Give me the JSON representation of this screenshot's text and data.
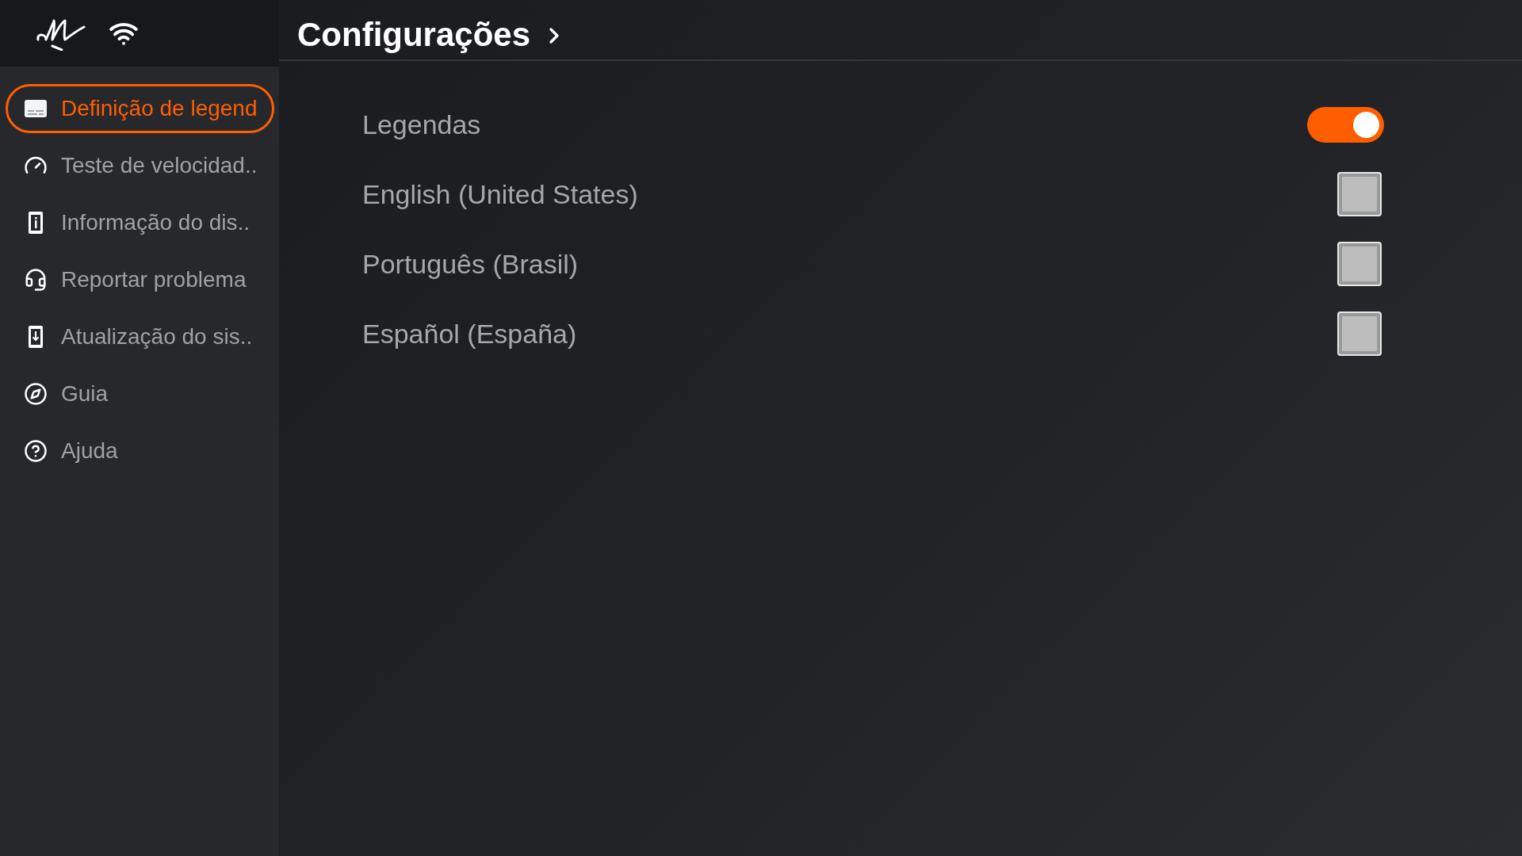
{
  "header": {
    "title": "Configurações"
  },
  "sidebar": {
    "items": [
      {
        "label": "Definição de legend",
        "selected": true
      },
      {
        "label": "Teste de velocidad..",
        "selected": false
      },
      {
        "label": "Informação do dis..",
        "selected": false
      },
      {
        "label": "Reportar problema",
        "selected": false
      },
      {
        "label": "Atualização do sis..",
        "selected": false
      },
      {
        "label": "Guia",
        "selected": false
      },
      {
        "label": "Ajuda",
        "selected": false
      }
    ]
  },
  "settings": {
    "rows": [
      {
        "kind": "toggle",
        "label": "Legendas",
        "on": true
      },
      {
        "kind": "checkbox",
        "label": "English (United States)",
        "checked": false
      },
      {
        "kind": "checkbox",
        "label": "Português (Brasil)",
        "checked": false
      },
      {
        "kind": "checkbox",
        "label": "Español (España)",
        "checked": false
      }
    ]
  }
}
